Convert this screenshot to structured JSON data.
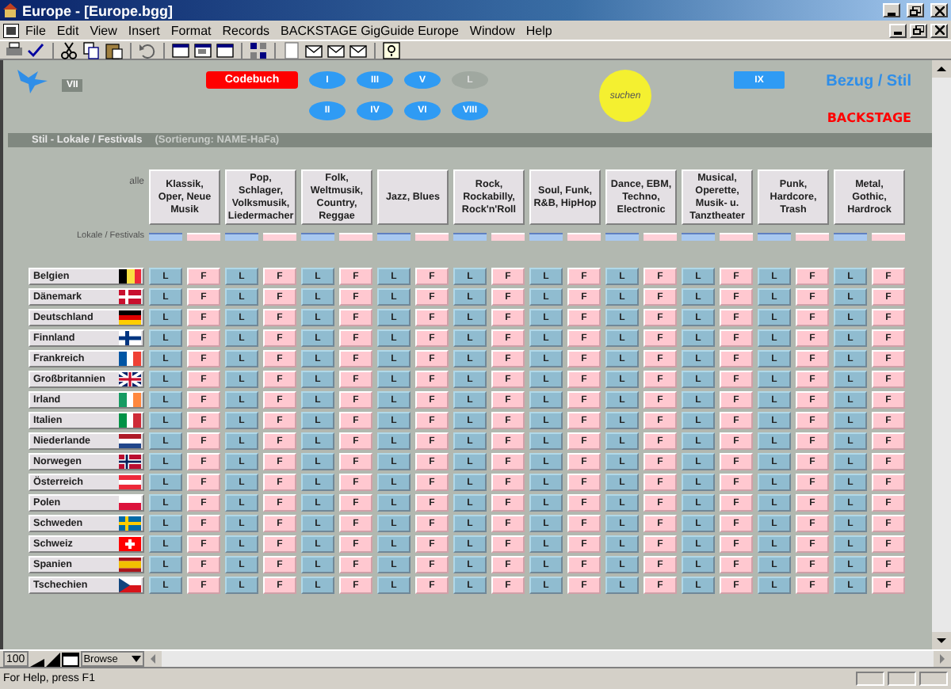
{
  "window": {
    "title": "Europe - [Europe.bgg]"
  },
  "menu": [
    "File",
    "Edit",
    "View",
    "Insert",
    "Format",
    "Records",
    "BACKSTAGE GigGuide Europe",
    "Window",
    "Help"
  ],
  "header": {
    "badge": "VII",
    "codebook_button": "Codebuch",
    "nav_buttons": [
      {
        "label": "I",
        "disabled": false
      },
      {
        "label": "III",
        "disabled": false
      },
      {
        "label": "V",
        "disabled": false
      },
      {
        "label": "L",
        "disabled": true
      },
      {
        "label": "II",
        "disabled": false
      },
      {
        "label": "IV",
        "disabled": false
      },
      {
        "label": "VI",
        "disabled": false
      },
      {
        "label": "VIII",
        "disabled": false
      }
    ],
    "search_button": "suchen",
    "ix_button": "IX",
    "heading": "Bezug / Stil",
    "brand": "BACKSTAGE"
  },
  "section": {
    "title": "Stil - Lokale / Festivals",
    "sorting": "(Sortierung: NAME-HaFa)"
  },
  "grid": {
    "all_label": "alle",
    "subheader_label": "Lokale / Festivals",
    "genres": [
      "Klassik, Oper, Neue Musik",
      "Pop, Schlager, Volksmusik, Liedermacher",
      "Folk, Weltmusik, Country, Reggae",
      "Jazz, Blues",
      "Rock, Rockabilly, Rock'n'Roll",
      "Soul, Funk, R&B, HipHop",
      "Dance, EBM, Techno, Electronic",
      "Musical, Operette, Musik- u. Tanztheater",
      "Punk, Hardcore, Trash",
      "Metal, Gothic, Hardrock"
    ],
    "rows": [
      {
        "country": "Belgien",
        "cells": [
          "L",
          "F",
          "L",
          "F",
          "L",
          "F",
          "L",
          "F",
          "L",
          "F",
          "L",
          "F",
          "L",
          "F",
          "L",
          "F",
          "L",
          "F",
          "L",
          "F"
        ]
      },
      {
        "country": "Dänemark",
        "cells": [
          "L",
          "F",
          "L",
          "F",
          "L",
          "F",
          "L",
          "F",
          "L",
          "F",
          "L",
          "F",
          "L",
          "F",
          "L",
          "F",
          "L",
          "F",
          "L",
          "F"
        ]
      },
      {
        "country": "Deutschland",
        "cells": [
          "L",
          "F",
          "L",
          "F",
          "L",
          "F",
          "L",
          "F",
          "L",
          "F",
          "L",
          "F",
          "L",
          "F",
          "L",
          "F",
          "L",
          "F",
          "L",
          "F"
        ]
      },
      {
        "country": "Finnland",
        "cells": [
          "L",
          "F",
          "L",
          "F",
          "L",
          "F",
          "L",
          "F",
          "L",
          "F",
          "L",
          "F",
          "L",
          "F",
          "L",
          "F",
          "L",
          "F",
          "L",
          "F"
        ]
      },
      {
        "country": "Frankreich",
        "cells": [
          "L",
          "F",
          "L",
          "F",
          "L",
          "F",
          "L",
          "F",
          "L",
          "F",
          "L",
          "F",
          "L",
          "F",
          "L",
          "F",
          "L",
          "F",
          "L",
          "F"
        ]
      },
      {
        "country": "Großbritannien",
        "cells": [
          "L",
          "F",
          "L",
          "F",
          "L",
          "F",
          "L",
          "F",
          "L",
          "F",
          "L",
          "F",
          "L",
          "F",
          "L",
          "F",
          "L",
          "F",
          "L",
          "F"
        ]
      },
      {
        "country": "Irland",
        "cells": [
          "L",
          "F",
          "L",
          "F",
          "L",
          "F",
          "L",
          "F",
          "L",
          "F",
          "L",
          "F",
          "L",
          "F",
          "L",
          "F",
          "L",
          "F",
          "L",
          "F"
        ]
      },
      {
        "country": "Italien",
        "cells": [
          "L",
          "F",
          "L",
          "F",
          "L",
          "F",
          "L",
          "F",
          "L",
          "F",
          "L",
          "F",
          "L",
          "F",
          "L",
          "F",
          "L",
          "F",
          "L",
          "F"
        ]
      },
      {
        "country": "Niederlande",
        "cells": [
          "L",
          "F",
          "L",
          "F",
          "L",
          "F",
          "L",
          "F",
          "L",
          "F",
          "L",
          "F",
          "L",
          "F",
          "L",
          "F",
          "L",
          "F",
          "L",
          "F"
        ]
      },
      {
        "country": "Norwegen",
        "cells": [
          "L",
          "F",
          "L",
          "F",
          "L",
          "F",
          "L",
          "F",
          "L",
          "F",
          "L",
          "F",
          "L",
          "F",
          "L",
          "F",
          "L",
          "F",
          "L",
          "F"
        ]
      },
      {
        "country": "Österreich",
        "cells": [
          "L",
          "F",
          "L",
          "F",
          "L",
          "F",
          "L",
          "F",
          "L",
          "F",
          "L",
          "F",
          "L",
          "F",
          "L",
          "F",
          "L",
          "F",
          "L",
          "F"
        ]
      },
      {
        "country": "Polen",
        "cells": [
          "L",
          "F",
          "L",
          "F",
          "L",
          "F",
          "L",
          "F",
          "L",
          "F",
          "L",
          "F",
          "L",
          "F",
          "L",
          "F",
          "L",
          "F",
          "L",
          "F"
        ]
      },
      {
        "country": "Schweden",
        "cells": [
          "L",
          "F",
          "L",
          "F",
          "L",
          "F",
          "L",
          "F",
          "L",
          "F",
          "L",
          "F",
          "L",
          "F",
          "L",
          "F",
          "L",
          "F",
          "L",
          "F"
        ]
      },
      {
        "country": "Schweiz",
        "cells": [
          "L",
          "F",
          "L",
          "F",
          "L",
          "F",
          "L",
          "F",
          "L",
          "F",
          "L",
          "F",
          "L",
          "F",
          "L",
          "F",
          "L",
          "F",
          "L",
          "F"
        ]
      },
      {
        "country": "Spanien",
        "cells": [
          "L",
          "F",
          "L",
          "F",
          "L",
          "F",
          "L",
          "F",
          "L",
          "F",
          "L",
          "F",
          "L",
          "F",
          "L",
          "F",
          "L",
          "F",
          "L",
          "F"
        ]
      },
      {
        "country": "Tschechien",
        "cells": [
          "L",
          "F",
          "L",
          "F",
          "L",
          "F",
          "L",
          "F",
          "L",
          "F",
          "L",
          "F",
          "L",
          "F",
          "L",
          "F",
          "L",
          "F",
          "L",
          "F"
        ]
      }
    ]
  },
  "bottom": {
    "zoom": "100",
    "mode": "Browse"
  },
  "status_bar": {
    "text": "For Help, press F1"
  }
}
